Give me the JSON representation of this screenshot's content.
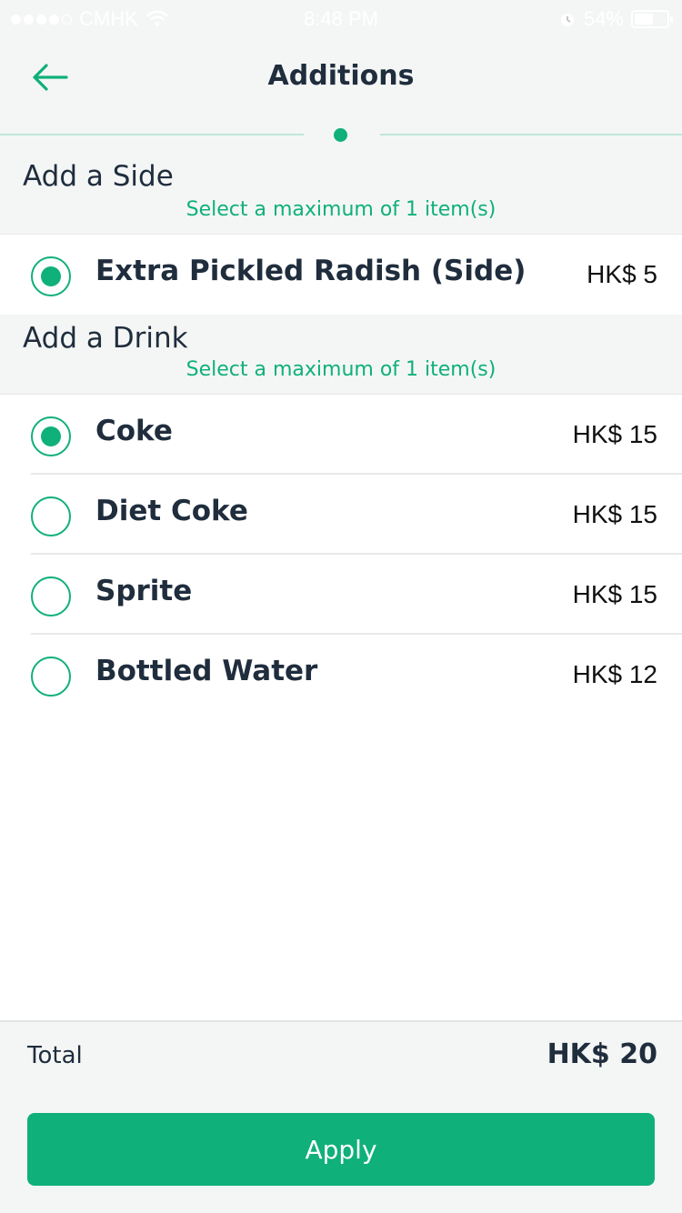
{
  "status_bar": {
    "carrier": "CMHK",
    "time": "8:48 PM",
    "battery": "54%",
    "signal_bars_filled": 4,
    "signal_bars_total": 5
  },
  "header": {
    "title": "Additions",
    "back_icon": "arrow-left-icon"
  },
  "sections": [
    {
      "title": "Add a Side",
      "subtitle": "Select a maximum of 1 item(s)",
      "items": [
        {
          "name": "Extra Pickled Radish (Side)",
          "price": "HK$ 5",
          "selected": true
        }
      ]
    },
    {
      "title": "Add a Drink",
      "subtitle": "Select a maximum of 1 item(s)",
      "items": [
        {
          "name": "Coke",
          "price": "HK$ 15",
          "selected": true
        },
        {
          "name": "Diet Coke",
          "price": "HK$ 15",
          "selected": false
        },
        {
          "name": "Sprite",
          "price": "HK$ 15",
          "selected": false
        },
        {
          "name": "Bottled Water",
          "price": "HK$ 12",
          "selected": false
        }
      ]
    }
  ],
  "footer": {
    "total_label": "Total",
    "total_value": "HK$ 20",
    "apply_label": "Apply"
  },
  "colors": {
    "accent": "#0fb07a",
    "text": "#1f2d3d",
    "background_gray": "#f4f6f5"
  }
}
